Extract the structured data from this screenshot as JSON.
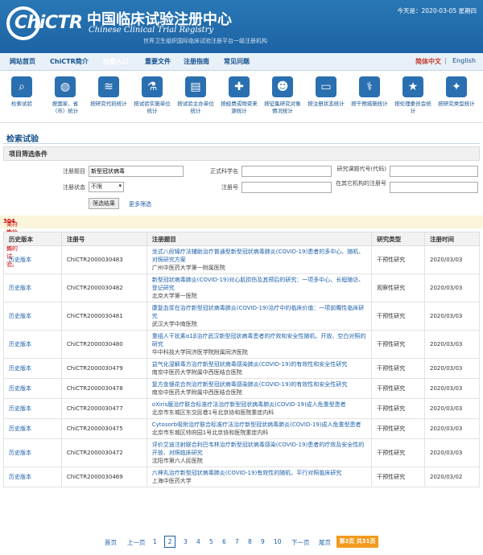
{
  "header": {
    "logo_text": "ChiCTR",
    "title_cn": "中国临床试验注册中心",
    "title_en": "Chinese Clinical Trial Registry",
    "subtitle": "世界卫生组织国际临床试验注册平台一级注册机构",
    "date": "今天是：2020-03-05 星期四"
  },
  "nav": {
    "items": [
      "网站首页",
      "ChiCTR简介",
      "检索入口",
      "重要文件",
      "注册指南",
      "常见问题"
    ],
    "lang_cn": "简体中文",
    "lang_sep": "|",
    "lang_en": "English"
  },
  "icons": [
    {
      "label": "检索试验",
      "icon": "search-icon"
    },
    {
      "label": "按国家、省（市）统计",
      "icon": "globe-icon"
    },
    {
      "label": "按研究代码统计",
      "icon": "dna-icon"
    },
    {
      "label": "按试验实施单位统计",
      "icon": "flask-icon"
    },
    {
      "label": "按试验主办单位统计",
      "icon": "clipboard-icon"
    },
    {
      "label": "按经费或物资来源统计",
      "icon": "medkit-icon"
    },
    {
      "label": "按征集研究对象情况统计",
      "icon": "people-icon"
    },
    {
      "label": "按注册状态统计",
      "icon": "ticket-icon"
    },
    {
      "label": "按干预措施统计",
      "icon": "doctor-icon"
    },
    {
      "label": "按伦理委员会统计",
      "icon": "star-icon"
    },
    {
      "label": "按研究类型统计",
      "icon": "sparkle-icon"
    }
  ],
  "page_title": "检索试验",
  "filter": {
    "header": "项目筛选条件",
    "reg_title_label": "注册题目",
    "reg_title_value": "新型冠状病毒",
    "sci_name_label": "正式科学名",
    "sci_name_value": "",
    "code_label": "研究课题代号(代码)",
    "code_value": "",
    "status_label": "注册状态",
    "status_value": "不限",
    "reg_no_label": "注册号",
    "reg_no_value": "",
    "other_reg_label": "在其它机构的注册号",
    "other_reg_value": "",
    "filter_button": "筛选结果",
    "more_filter": "更多筛选"
  },
  "result": {
    "prefix": "共检索到",
    "count": "304",
    "suffix": "个符合检索条件的试验。"
  },
  "table": {
    "headers": [
      "历史版本",
      "注册号",
      "注册题目",
      "研究类型",
      "注册时间"
    ],
    "rows": [
      {
        "hist": "历史版本",
        "reg_no": "ChiCTR2000030483",
        "title": "坐式八段锦疗法辅助治疗普通型新型冠状病毒肺炎(COVID-19)患者的多中心、随机、对照研究方案",
        "org": "广州中医药大学第一附属医院",
        "type": "干预性研究",
        "date": "2020/03/03"
      },
      {
        "hist": "历史版本",
        "reg_no": "ChiCTR2000030482",
        "title": "新型冠状病毒肺炎(COVID-19)对心肌损伤及其预后的研究：一项多中心、长程随访、登记研究",
        "org": "北京大学第一医院",
        "type": "观察性研究",
        "date": "2020/03/03"
      },
      {
        "hist": "历史版本",
        "reg_no": "ChiCTR2000030481",
        "title": "康复血浆在治疗新型冠状病毒肺炎(COVID-19)治疗中的临床价值：一项前瞻性临床研究",
        "org": "武汉大学中南医院",
        "type": "干预性研究",
        "date": "2020/03/03"
      },
      {
        "hist": "历史版本",
        "reg_no": "ChiCTR2000030480",
        "title": "重组人干扰素α1β治疗武汉新型冠状病毒患者的疗效和安全性随机、开放、空白对照的研究",
        "org": "华中科技大学同济医学院附属同济医院",
        "type": "干预性研究",
        "date": "2020/03/03"
      },
      {
        "hist": "历史版本",
        "reg_no": "ChiCTR2000030479",
        "title": "益气化湿解毒方治疗新型冠状病毒感染肺炎(COVID-19)的有效性和安全性研究",
        "org": "南京中医药大学附属中西医结合医院",
        "type": "干预性研究",
        "date": "2020/03/03"
      },
      {
        "hist": "历史版本",
        "reg_no": "ChiCTR2000030478",
        "title": "复方金银花合剂治疗新型冠状病毒感染肺炎(COVID-19)的有效性和安全性研究",
        "org": "南京中医药大学附属中西医结合医院",
        "type": "干预性研究",
        "date": "2020/03/03"
      },
      {
        "hist": "历史版本",
        "reg_no": "ChiCTR2000030477",
        "title": "oXiris膜治疗联合标准疗法治疗新型冠状病毒肺炎(COVID-19)成人危重型患者",
        "org": "北京市东城区东交民巷1号北京协和医院重症内科",
        "type": "干预性研究",
        "date": "2020/03/03"
      },
      {
        "hist": "历史版本",
        "reg_no": "ChiCTR2000030475",
        "title": "Cytosorb吸附治疗联合标准疗法治疗新型冠状病毒肺炎(COVID-19)成人危重型患者",
        "org": "北京市东城区帅府园1号北京协和医院重症内科",
        "type": "干预性研究",
        "date": "2020/03/03"
      },
      {
        "hist": "历史版本",
        "reg_no": "ChiCTR2000030472",
        "title": "评价艾迪注射联合利巴韦林治疗新型冠状病毒感染(COVID-19)患者的疗效及安全性的开放、对照临床研究",
        "org": "沈阳市第六人民医院",
        "type": "干预性研究",
        "date": "2020/03/03"
      },
      {
        "hist": "历史版本",
        "reg_no": "ChiCTR2000030469",
        "title": "六神丸治疗新型冠状病毒肺炎(COVID-19)有效性的随机、平行对照临床研究",
        "org": "上海中医药大学",
        "type": "干预性研究",
        "date": "2020/03/02"
      }
    ]
  },
  "pager": {
    "first": "首页",
    "prev": "上一页",
    "pages": [
      "1",
      "2",
      "3",
      "4",
      "5",
      "6",
      "7",
      "8",
      "9",
      "10"
    ],
    "current": "2",
    "next": "下一页",
    "last": "尾页",
    "info": "第2页 共31页"
  }
}
